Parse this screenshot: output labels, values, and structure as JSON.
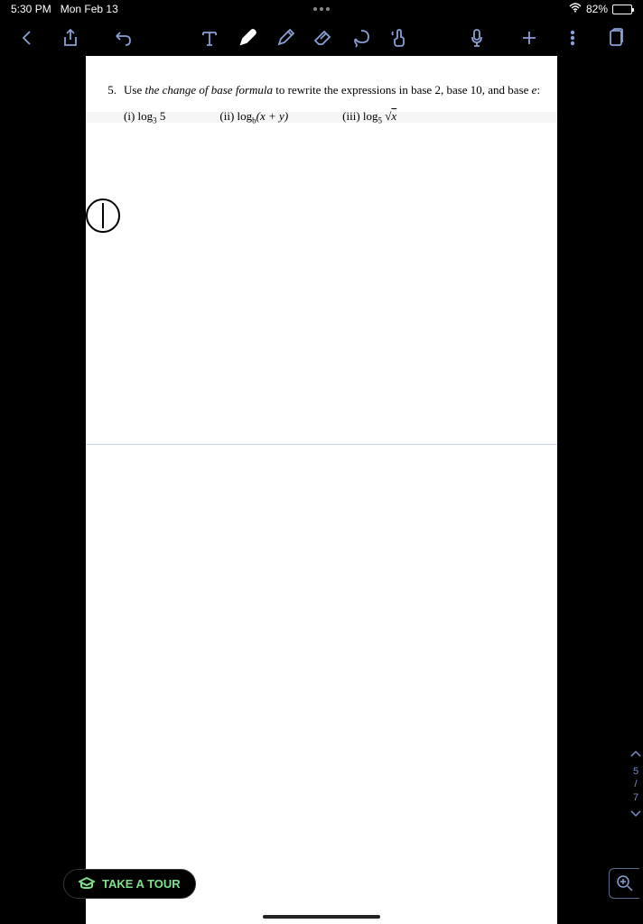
{
  "status": {
    "time": "5:30 PM",
    "date": "Mon Feb 13",
    "battery": "82%"
  },
  "toolbar": {
    "back": "back",
    "share": "share",
    "undo": "undo",
    "text": "text",
    "pen": "pen",
    "pencil": "pencil",
    "eraser": "eraser",
    "lasso": "lasso",
    "hand": "hand",
    "mic": "microphone",
    "add": "add",
    "more": "more",
    "pages": "pages"
  },
  "document": {
    "problem_number": "5.",
    "problem_intro": "Use ",
    "problem_italic": "the change of base formula",
    "problem_rest": " to rewrite the expressions in base 2, base 10, and base ",
    "problem_e": "e",
    "problem_colon": ":",
    "part_i_label": "(i)",
    "part_i_expr": "log",
    "part_i_sub": "3",
    "part_i_arg": " 5",
    "part_ii_label": "(ii)",
    "part_ii_expr": "log",
    "part_ii_sub": "b",
    "part_ii_arg": "(x + y)",
    "part_iii_label": "(iii)",
    "part_iii_expr": "log",
    "part_iii_sub": "5",
    "part_iii_sqrt": "√",
    "part_iii_arg": "x"
  },
  "pagenav": {
    "current": "5",
    "sep": "/",
    "total": "7"
  },
  "tour": {
    "label": "TAKE A TOUR"
  }
}
